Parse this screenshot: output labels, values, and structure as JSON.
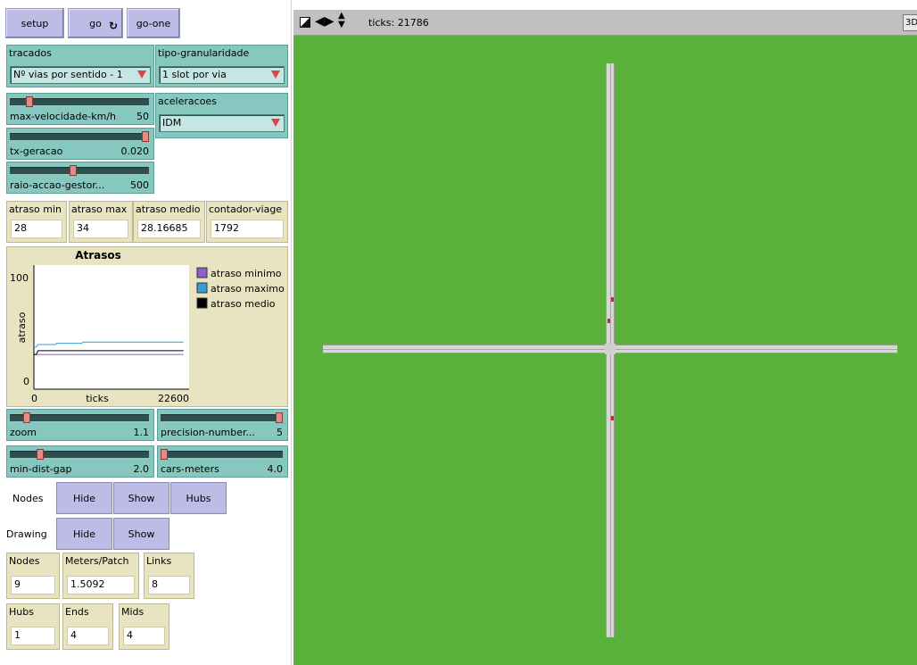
{
  "buttons": {
    "setup": "setup",
    "go": "go",
    "go_one": "go-one"
  },
  "choosers": {
    "tracados": {
      "label": "tracados",
      "value": "Nº vias por sentido - 1"
    },
    "granularidade": {
      "label": "tipo-granularidade",
      "value": "1 slot por via"
    },
    "aceleracoes": {
      "label": "aceleracoes",
      "value": "IDM"
    }
  },
  "sliders": {
    "velocidade": {
      "label": "max-velocidade-km/h",
      "value": "50",
      "fraction": 0.12
    },
    "geracao": {
      "label": "tx-geracao",
      "value": "0.020",
      "fraction": 1.0
    },
    "raio": {
      "label": "raio-accao-gestor...",
      "value": "500",
      "fraction": 0.45
    },
    "zoom": {
      "label": "zoom",
      "value": "1.1",
      "fraction": 0.1
    },
    "precision": {
      "label": "precision-number...",
      "value": "5",
      "fraction": 1.0
    },
    "mindist": {
      "label": "min-dist-gap",
      "value": "2.0",
      "fraction": 0.2
    },
    "carsmeters": {
      "label": "cars-meters",
      "value": "4.0",
      "fraction": 0.0
    }
  },
  "monitors": {
    "atraso_min": {
      "label": "atraso min",
      "value": "28"
    },
    "atraso_max": {
      "label": "atraso max",
      "value": "34"
    },
    "atraso_medio": {
      "label": "atraso medio",
      "value": "28.16685"
    },
    "contador": {
      "label": "contador-viage",
      "value": "1792"
    },
    "nodes": {
      "label": "Nodes",
      "value": "9"
    },
    "meters": {
      "label": "Meters/Patch",
      "value": "1.5092"
    },
    "links": {
      "label": "Links",
      "value": "8"
    },
    "hubs": {
      "label": "Hubs",
      "value": "1"
    },
    "ends": {
      "label": "Ends",
      "value": "4"
    },
    "mids": {
      "label": "Mids",
      "value": "4"
    }
  },
  "plot": {
    "title": "Atrasos",
    "ylabel": "atraso",
    "xlabel": "ticks",
    "ymax_label": "100",
    "ymin_label": "0",
    "xmin_label": "0",
    "xmax_label": "22600",
    "legend": [
      {
        "name": "atraso minimo",
        "color": "#8e5fc8"
      },
      {
        "name": "atraso maximo",
        "color": "#3c9ad4"
      },
      {
        "name": "atraso medio",
        "color": "#000000"
      }
    ]
  },
  "chart_data": {
    "type": "line",
    "title": "Atrasos",
    "xlabel": "ticks",
    "ylabel": "atraso",
    "xlim": [
      0,
      22600
    ],
    "ylim": [
      0,
      100
    ],
    "series": [
      {
        "name": "atraso minimo",
        "color": "#8e5fc8",
        "x": [
          0,
          350,
          21786
        ],
        "y": [
          28,
          28,
          28
        ]
      },
      {
        "name": "atraso maximo",
        "color": "#3c9ad4",
        "x": [
          0,
          350,
          600,
          3200,
          3300,
          7000,
          7100,
          21786
        ],
        "y": [
          34,
          34,
          36,
          36,
          37,
          37,
          38,
          38
        ]
      },
      {
        "name": "atraso medio",
        "color": "#000000",
        "x": [
          0,
          350,
          600,
          21786
        ],
        "y": [
          28,
          28,
          31,
          31
        ]
      }
    ]
  },
  "rows": {
    "nodes": {
      "label": "Nodes",
      "hide": "Hide",
      "show": "Show",
      "hubs": "Hubs"
    },
    "drawing": {
      "label": "Drawing",
      "hide": "Hide",
      "show": "Show"
    }
  },
  "view": {
    "ticks_label": "ticks: 21786",
    "btn3d": "3D",
    "bg": "#59b03a"
  }
}
